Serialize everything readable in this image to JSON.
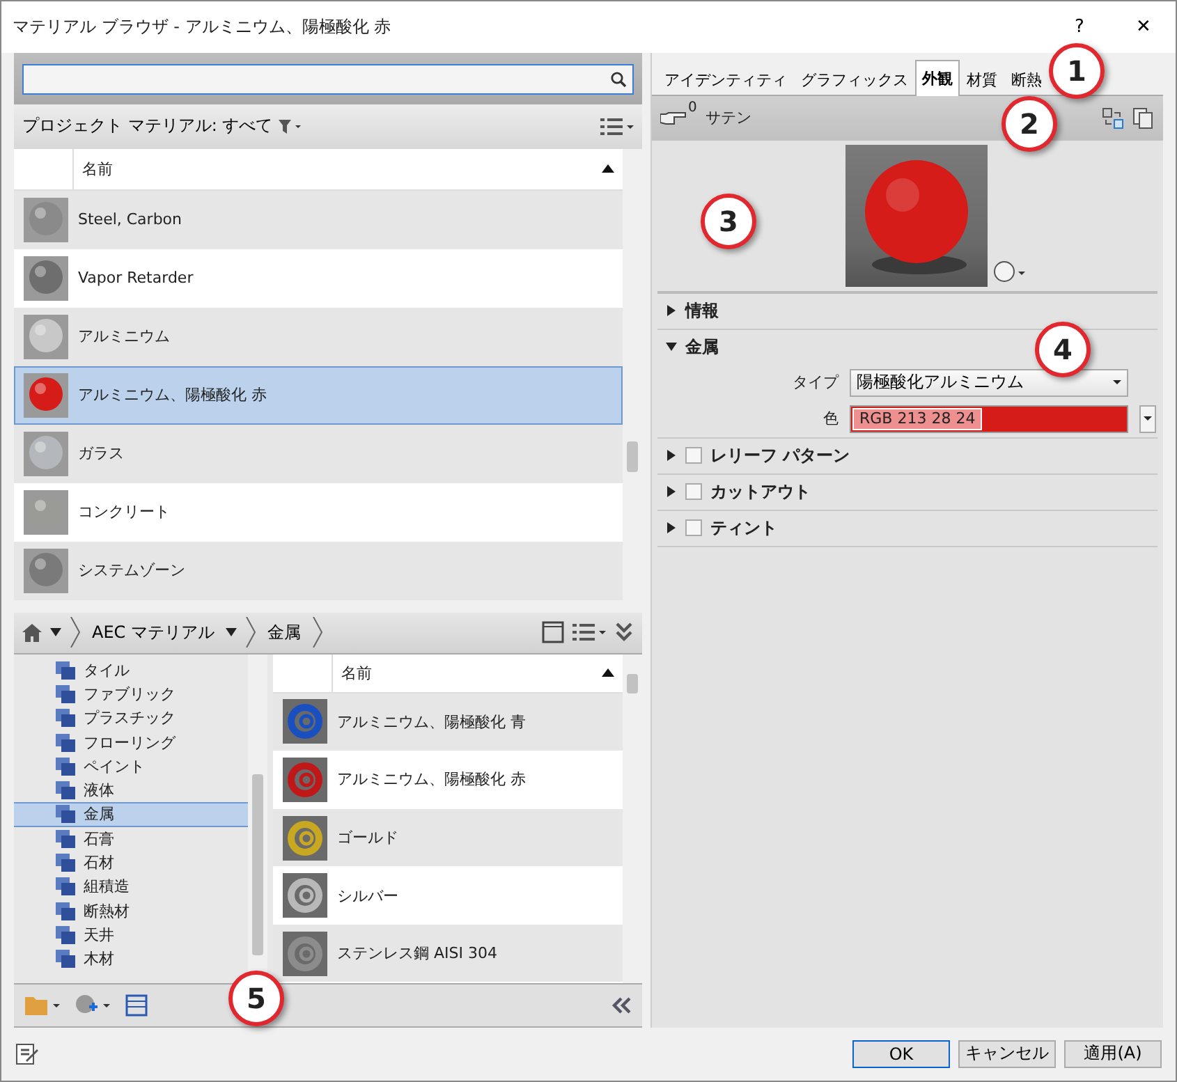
{
  "window": {
    "title": "マテリアル ブラウザ - アルミニウム、陽極酸化 赤",
    "help": "?",
    "close": "✕"
  },
  "filter": {
    "label": "プロジェクト マテリアル: すべて"
  },
  "project_table": {
    "column": "名前",
    "rows": [
      {
        "name": "Steel, Carbon",
        "color": "#8a8a8a",
        "selected": false
      },
      {
        "name": "Vapor Retarder",
        "color": "#6e6e6e",
        "selected": false
      },
      {
        "name": "アルミニウム",
        "color": "#c8c8c8",
        "selected": false
      },
      {
        "name": "アルミニウム、陽極酸化 赤",
        "color": "#d51c18",
        "selected": true
      },
      {
        "name": "ガラス",
        "color": "#b4b8bc",
        "selected": false
      },
      {
        "name": "コンクリート",
        "color": "#9a9a96",
        "selected": false
      },
      {
        "name": "システムゾーン",
        "color": "#7a7a7a",
        "selected": false
      }
    ]
  },
  "breadcrumb": [
    "AEC マテリアル",
    "金属"
  ],
  "library_tree": [
    {
      "label": "タイル",
      "selected": false
    },
    {
      "label": "ファブリック",
      "selected": false
    },
    {
      "label": "プラスチック",
      "selected": false
    },
    {
      "label": "フローリング",
      "selected": false
    },
    {
      "label": "ペイント",
      "selected": false
    },
    {
      "label": "液体",
      "selected": false
    },
    {
      "label": "金属",
      "selected": true
    },
    {
      "label": "石膏",
      "selected": false
    },
    {
      "label": "石材",
      "selected": false
    },
    {
      "label": "組積造",
      "selected": false
    },
    {
      "label": "断熱材",
      "selected": false
    },
    {
      "label": "天井",
      "selected": false
    },
    {
      "label": "木材",
      "selected": false
    }
  ],
  "library_table": {
    "column": "名前",
    "rows": [
      {
        "name": "アルミニウム、陽極酸化 青",
        "color": "#1a4fc0"
      },
      {
        "name": "アルミニウム、陽極酸化 赤",
        "color": "#c01818"
      },
      {
        "name": "ゴールド",
        "color": "#c8a820"
      },
      {
        "name": "シルバー",
        "color": "#b8b8b8"
      },
      {
        "name": "ステンレス鋼 AISI 304",
        "color": "#8c8c8c"
      }
    ]
  },
  "tabs": [
    {
      "label": "アイデンティティ",
      "selected": false
    },
    {
      "label": "グラフィックス",
      "selected": false
    },
    {
      "label": "外観",
      "selected": true
    },
    {
      "label": "材質",
      "selected": false
    },
    {
      "label": "断熱",
      "selected": false
    }
  ],
  "asset": {
    "count": "0",
    "name": "サテン"
  },
  "sections": [
    {
      "title": "情報",
      "kind": "plain",
      "expanded": false
    },
    {
      "title": "金属",
      "kind": "plain",
      "expanded": true,
      "fields": [
        {
          "label": "タイプ",
          "kind": "dropdown",
          "value": "陽極酸化アルミニウム"
        },
        {
          "label": "色",
          "kind": "color",
          "value": "RGB 213 28 24",
          "color": "#d51c18"
        }
      ]
    },
    {
      "title": "レリーフ パターン",
      "kind": "check",
      "expanded": false,
      "checked": false
    },
    {
      "title": "カットアウト",
      "kind": "check",
      "expanded": false,
      "checked": false
    },
    {
      "title": "ティント",
      "kind": "check",
      "expanded": false,
      "checked": false
    }
  ],
  "buttons": [
    "OK",
    "キャンセル",
    "適用(A)"
  ],
  "callouts": [
    "1",
    "2",
    "3",
    "4",
    "5"
  ]
}
